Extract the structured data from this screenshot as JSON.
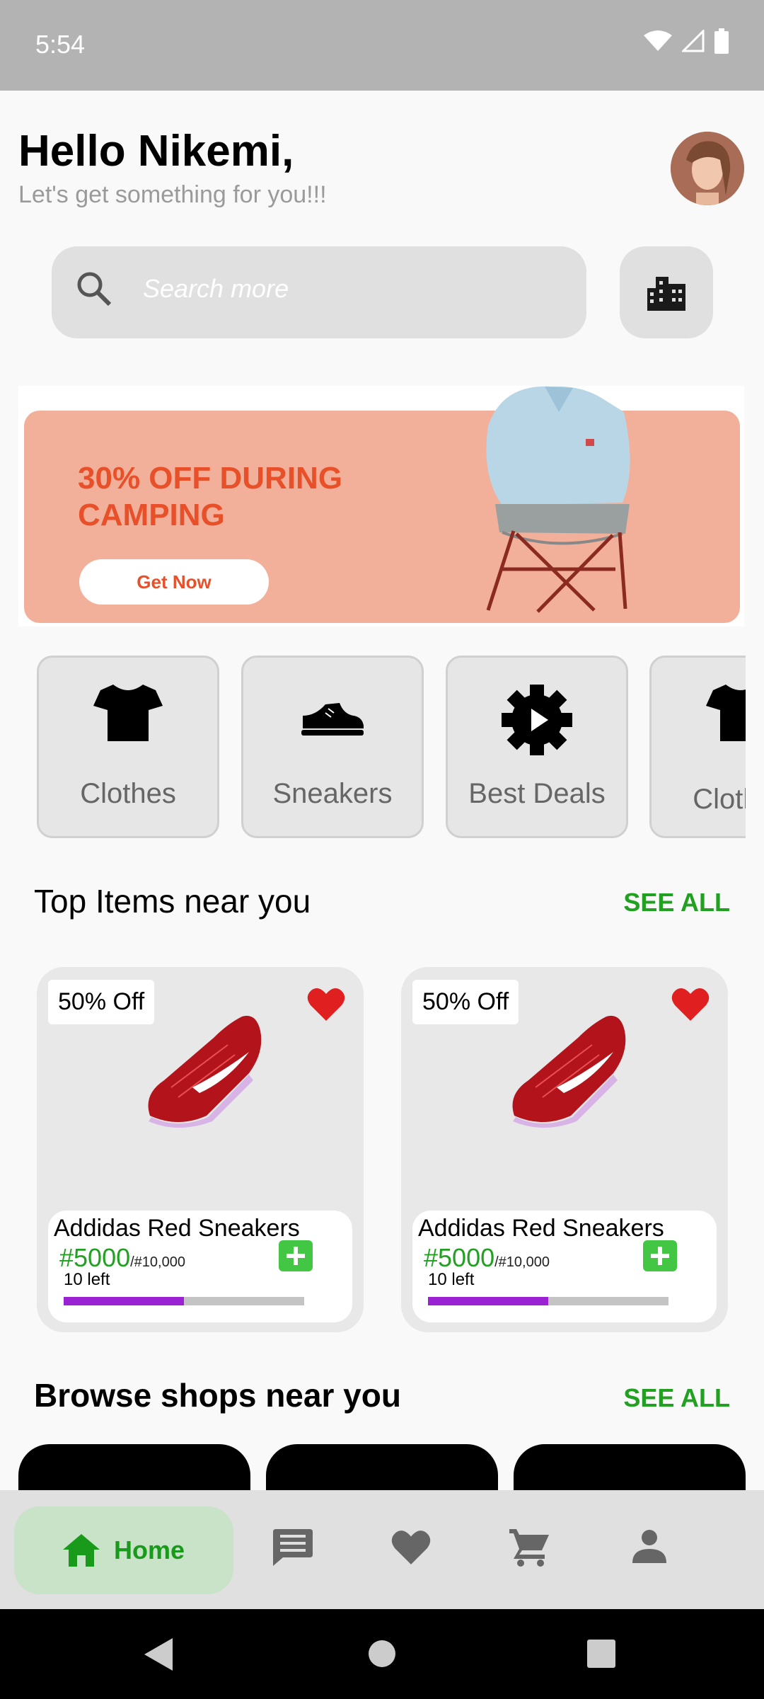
{
  "status_bar": {
    "time": "5:54"
  },
  "header": {
    "greeting": "Hello Nikemi,",
    "subtitle": "Let's get something for you!!!"
  },
  "search": {
    "placeholder": "Search more"
  },
  "banner": {
    "title": "30% OFF DURING CAMPING",
    "button": "Get Now"
  },
  "categories": [
    {
      "label": "Clothes",
      "icon": "tshirt-icon"
    },
    {
      "label": "Sneakers",
      "icon": "sneaker-icon"
    },
    {
      "label": "Best Deals",
      "icon": "deals-icon"
    },
    {
      "label": "Clothes",
      "icon": "tshirt-icon"
    }
  ],
  "top_items": {
    "title": "Top Items near you",
    "see_all": "SEE ALL",
    "items": [
      {
        "badge": "50% Off",
        "name": "Addidas Red Sneakers",
        "price": "#5000",
        "old_price": "/#10,000",
        "stock": "10 left",
        "progress": 0.5
      },
      {
        "badge": "50% Off",
        "name": "Addidas Red Sneakers",
        "price": "#5000",
        "old_price": "/#10,000",
        "stock": "10 left",
        "progress": 0.5
      }
    ]
  },
  "shops": {
    "title": "Browse shops near you",
    "see_all": "SEE ALL"
  },
  "bottom_nav": {
    "home": "Home"
  },
  "colors": {
    "accent": "#22a022",
    "progress": "#9a22d3",
    "banner": "#f2b09b",
    "heart": "#e02020"
  }
}
